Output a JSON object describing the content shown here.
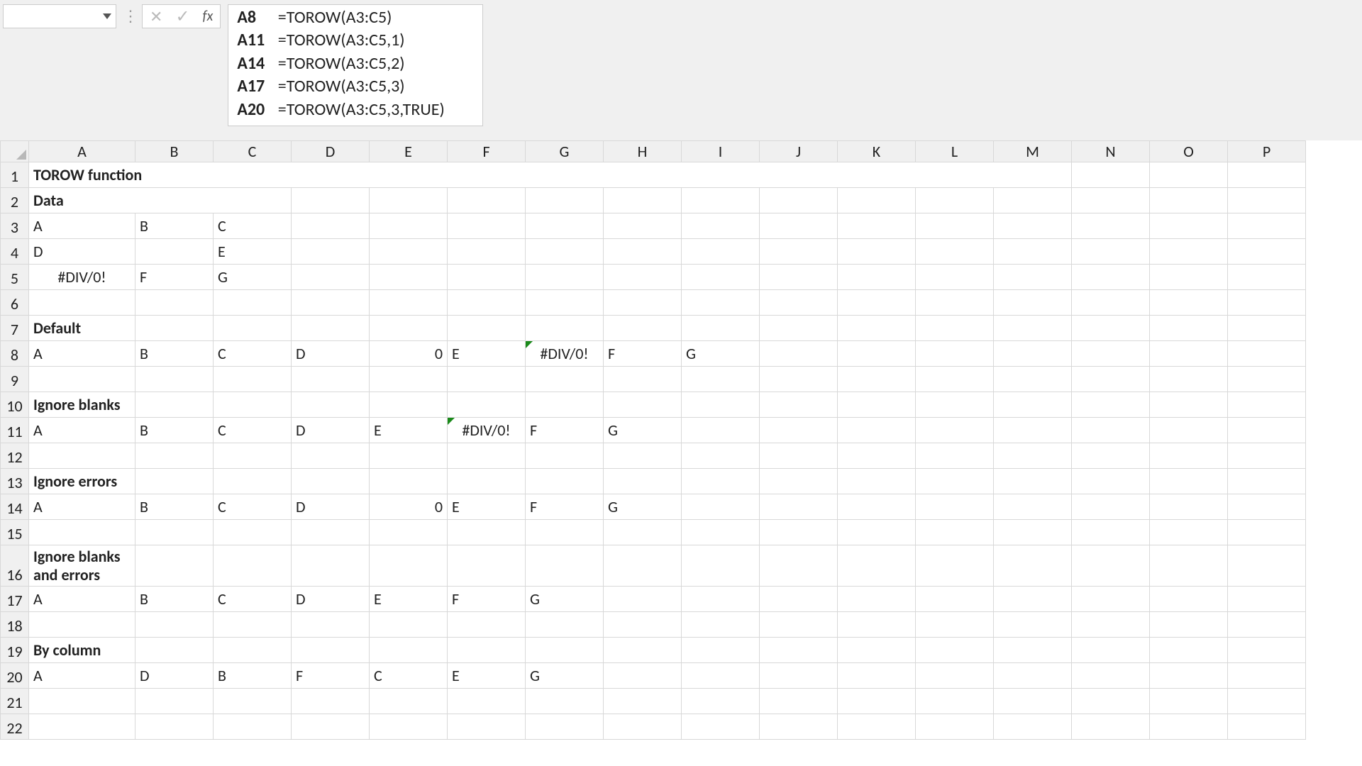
{
  "formula_bar": {
    "name_box_value": "",
    "fx_label": "fx",
    "rows": [
      {
        "ref": "A8",
        "formula": "=TOROW(A3:C5)"
      },
      {
        "ref": "A11",
        "formula": "=TOROW(A3:C5,1)"
      },
      {
        "ref": "A14",
        "formula": "=TOROW(A3:C5,2)"
      },
      {
        "ref": "A17",
        "formula": "=TOROW(A3:C5,3)"
      },
      {
        "ref": "A20",
        "formula": "=TOROW(A3:C5,3,TRUE)"
      }
    ]
  },
  "columns": [
    "A",
    "B",
    "C",
    "D",
    "E",
    "F",
    "G",
    "H",
    "I",
    "J",
    "K",
    "L",
    "M",
    "N",
    "O",
    "P"
  ],
  "rows": [
    "1",
    "2",
    "3",
    "4",
    "5",
    "6",
    "7",
    "8",
    "9",
    "10",
    "11",
    "12",
    "13",
    "14",
    "15",
    "16",
    "17",
    "18",
    "19",
    "20",
    "21",
    "22"
  ],
  "titles": {
    "main": "TOROW function",
    "data": "Data",
    "default": "Default",
    "ignore_blanks": "Ignore blanks",
    "ignore_errors": "Ignore errors",
    "ignore_both": "Ignore blanks and errors",
    "by_column": "By column"
  },
  "cells": {
    "A3": "A",
    "B3": "B",
    "C3": "C",
    "A4": "D",
    "B4": "",
    "C4": "E",
    "A5": "#DIV/0!",
    "B5": "F",
    "C5": "G",
    "A8": "A",
    "B8": "B",
    "C8": "C",
    "D8": "D",
    "E8": "0",
    "F8": "E",
    "G8": "#DIV/0!",
    "H8": "F",
    "I8": "G",
    "A11": "A",
    "B11": "B",
    "C11": "C",
    "D11": "D",
    "E11": "E",
    "F11": "#DIV/0!",
    "G11": "F",
    "H11": "G",
    "A14": "A",
    "B14": "B",
    "C14": "C",
    "D14": "D",
    "E14": "0",
    "F14": "E",
    "G14": "F",
    "H14": "G",
    "A17": "A",
    "B17": "B",
    "C17": "C",
    "D17": "D",
    "E17": "E",
    "F17": "F",
    "G17": "G",
    "A20": "A",
    "B20": "D",
    "C20": "B",
    "D20": "F",
    "E20": "C",
    "F20": "E",
    "G20": "G"
  },
  "chart_data": {
    "type": "table",
    "title": "TOROW function",
    "input_range": "A3:C5",
    "input": [
      [
        "A",
        "B",
        "C"
      ],
      [
        "D",
        "",
        "E"
      ],
      [
        "#DIV/0!",
        "F",
        "G"
      ]
    ],
    "outputs": [
      {
        "label": "Default",
        "formula": "=TOROW(A3:C5)",
        "values": [
          "A",
          "B",
          "C",
          "D",
          0,
          "E",
          "#DIV/0!",
          "F",
          "G"
        ]
      },
      {
        "label": "Ignore blanks",
        "formula": "=TOROW(A3:C5,1)",
        "values": [
          "A",
          "B",
          "C",
          "D",
          "E",
          "#DIV/0!",
          "F",
          "G"
        ]
      },
      {
        "label": "Ignore errors",
        "formula": "=TOROW(A3:C5,2)",
        "values": [
          "A",
          "B",
          "C",
          "D",
          0,
          "E",
          "F",
          "G"
        ]
      },
      {
        "label": "Ignore blanks and errors",
        "formula": "=TOROW(A3:C5,3)",
        "values": [
          "A",
          "B",
          "C",
          "D",
          "E",
          "F",
          "G"
        ]
      },
      {
        "label": "By column",
        "formula": "=TOROW(A3:C5,3,TRUE)",
        "values": [
          "A",
          "D",
          "B",
          "F",
          "C",
          "E",
          "G"
        ]
      }
    ]
  }
}
